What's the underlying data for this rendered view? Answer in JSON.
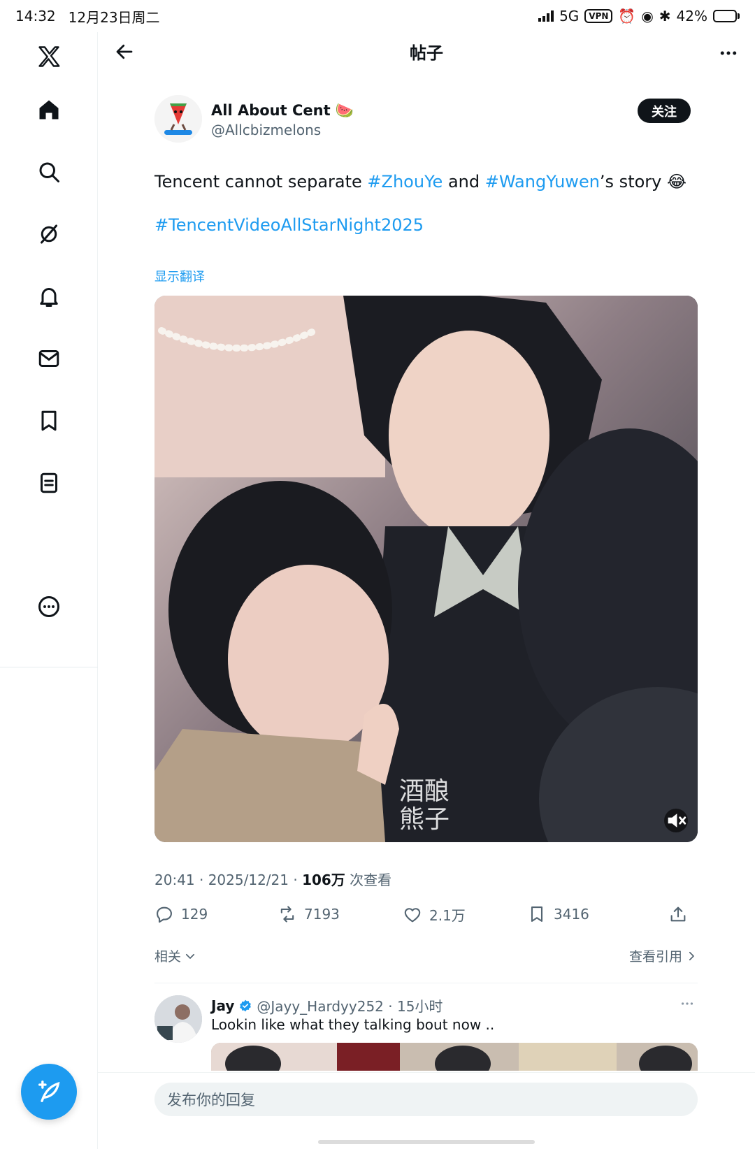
{
  "status_bar": {
    "time": "14:32",
    "date": "12月23日周二",
    "network": "5G",
    "vpn": "VPN",
    "battery": "42%",
    "battery_level": 0.42
  },
  "header": {
    "title": "帖子"
  },
  "post": {
    "author_name": "All About Cent 🍉",
    "author_handle": "@Allcbizmelons",
    "follow_label": "关注",
    "text_prefix": "Tencent cannot separate ",
    "hashtag1": "#ZhouYe",
    "text_mid": " and ",
    "hashtag2": "#WangYuwen",
    "text_suffix": "’s story 😂",
    "hashtag3": "#TencentVideoAllStarNight2025",
    "translate_label": "显示翻译",
    "watermark": "酒酿\n熊子",
    "timestamp": "20:41 · 2025/12/21 · ",
    "views_count": "106万",
    "views_label": " 次查看",
    "stats": {
      "replies": "129",
      "reposts": "7193",
      "likes": "2.1万",
      "bookmarks": "3416"
    },
    "related_label": "相关",
    "quotes_label": "查看引用"
  },
  "reply": {
    "name": "Jay",
    "handle_time": "@Jayy_Hardyy252 · 15小时",
    "text": "Lookin like what they talking bout now .."
  },
  "composer": {
    "placeholder": "发布你的回复"
  },
  "colors": {
    "accent": "#1d9bf0",
    "text": "#0f1419",
    "secondary": "#536471"
  }
}
